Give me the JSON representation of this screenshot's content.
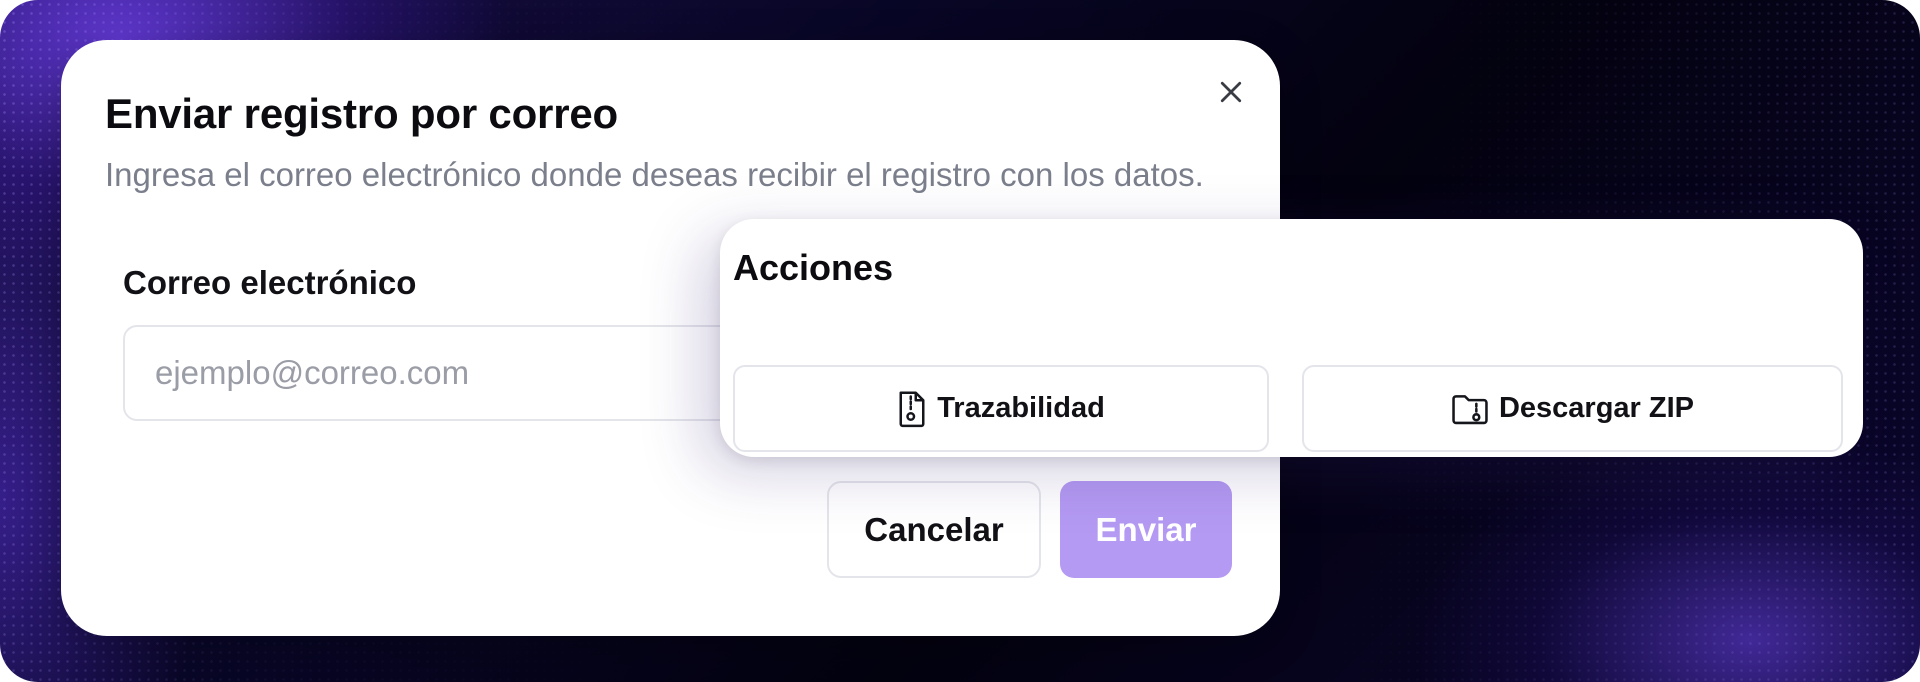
{
  "dialog": {
    "title": "Enviar registro por correo",
    "description": "Ingresa el correo electrónico donde deseas recibir el registro con los datos.",
    "close_icon": "close-icon",
    "email_label": "Correo electrónico",
    "email_placeholder": "ejemplo@correo.com",
    "email_value": "",
    "cancel_label": "Cancelar",
    "send_label": "Enviar",
    "send_color": "#b49af2"
  },
  "actions": {
    "title": "Acciones",
    "trace": {
      "label": "Trazabilidad",
      "icon": "file-zip-icon"
    },
    "zip": {
      "label": "Descargar ZIP",
      "icon": "folder-zip-icon"
    }
  },
  "background": {
    "accent": "#5b2fd6"
  }
}
